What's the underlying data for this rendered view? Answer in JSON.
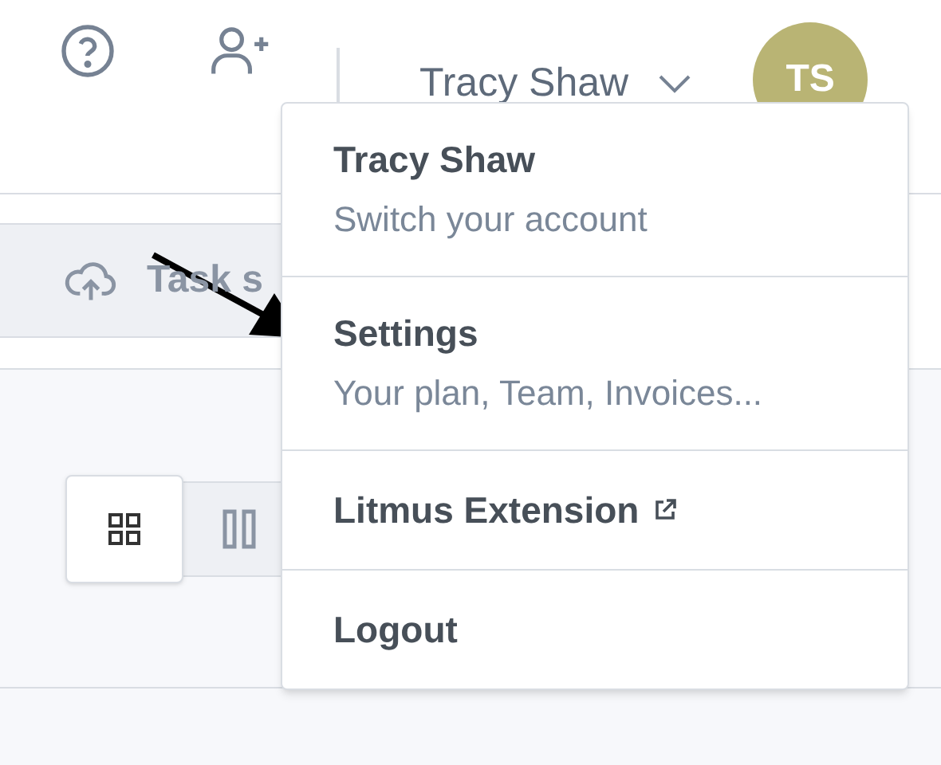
{
  "header": {
    "user_name": "Tracy Shaw",
    "avatar_initials": "TS"
  },
  "toolbar": {
    "task_button": "Task s"
  },
  "view_toggle": [
    {
      "kind": "grid",
      "selected": true
    },
    {
      "kind": "columns",
      "selected": false
    }
  ],
  "account_menu": {
    "items": [
      {
        "title": "Tracy Shaw",
        "subtitle": "Switch your account",
        "external": false
      },
      {
        "title": "Settings",
        "subtitle": "Your plan, Team, Invoices...",
        "external": false
      },
      {
        "title": "Litmus Extension",
        "external": true
      },
      {
        "title": "Logout",
        "external": false
      }
    ]
  }
}
